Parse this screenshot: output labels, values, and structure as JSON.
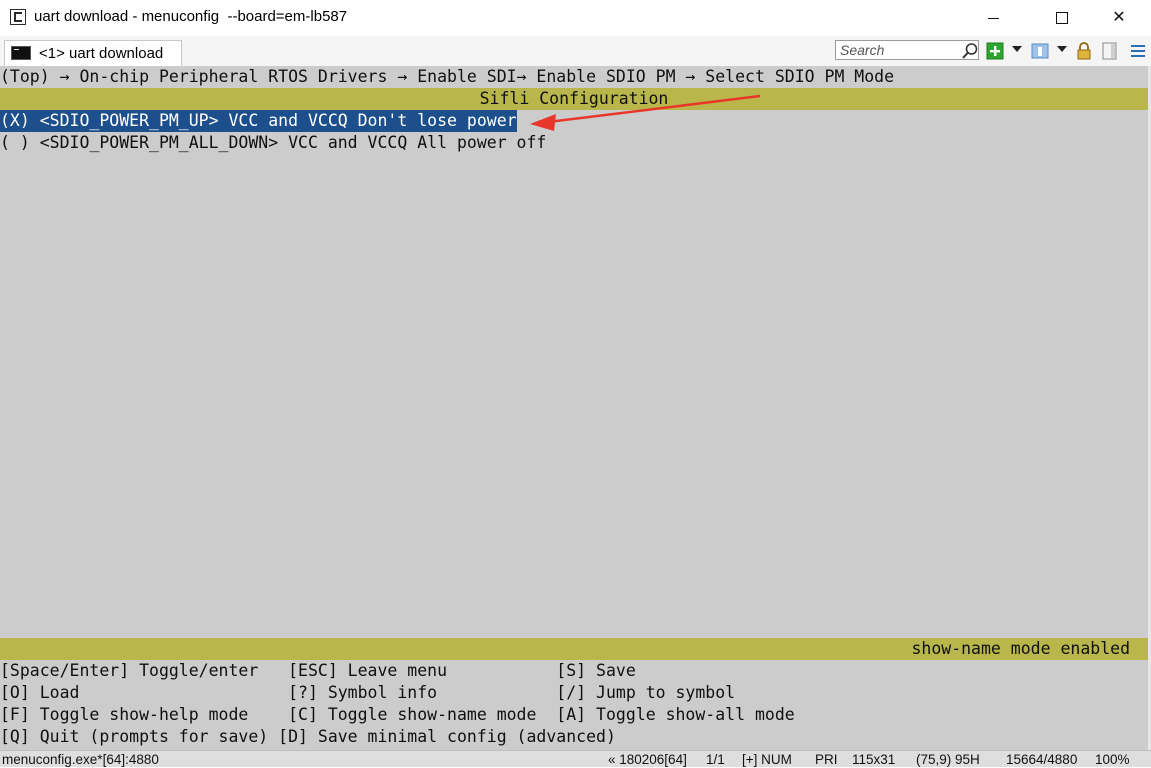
{
  "window": {
    "title": "uart download - menuconfig  --board=em-lb587",
    "minimize": "minimize",
    "maximize": "maximize",
    "close": "✕"
  },
  "toolbar": {
    "tab_label": "<1> uart download",
    "search_placeholder": "Search",
    "icons": [
      "new-console-icon",
      "view-icon",
      "lock-icon",
      "panel-icon",
      "menu-icon"
    ]
  },
  "terminal": {
    "breadcrumb": "(Top) → On-chip Peripheral RTOS Drivers → Enable SDI→ Enable SDIO PM → Select SDIO PM Mode",
    "header": "Sifli Configuration",
    "options": [
      {
        "text": "(X) <SDIO_POWER_PM_UP> VCC and VCCQ Don't lose power",
        "selected": true
      },
      {
        "text": "( ) <SDIO_POWER_PM_ALL_DOWN> VCC and VCCQ All power off",
        "selected": false
      }
    ],
    "mode_status": "show-name mode enabled",
    "help_lines": [
      "[Space/Enter] Toggle/enter   [ESC] Leave menu           [S] Save",
      "[O] Load                     [?] Symbol info            [/] Jump to symbol",
      "[F] Toggle show-help mode    [C] Toggle show-name mode  [A] Toggle show-all mode",
      "[Q] Quit (prompts for save) [D] Save minimal config (advanced)"
    ],
    "colors": {
      "background": "#cccccc",
      "header_bar": "#b9b64b",
      "selection": "#1c4f8c",
      "annotation_arrow": "#e8372a"
    }
  },
  "statusbar": {
    "process": "menuconfig.exe*[64]:4880",
    "build": "« 180206[64]",
    "page": "1/1",
    "flags": "[+] NUM",
    "priority": "PRI",
    "size": "115x31",
    "cursor": "(75,9) 95H",
    "pid": "15664/4880",
    "zoom": "100%"
  }
}
